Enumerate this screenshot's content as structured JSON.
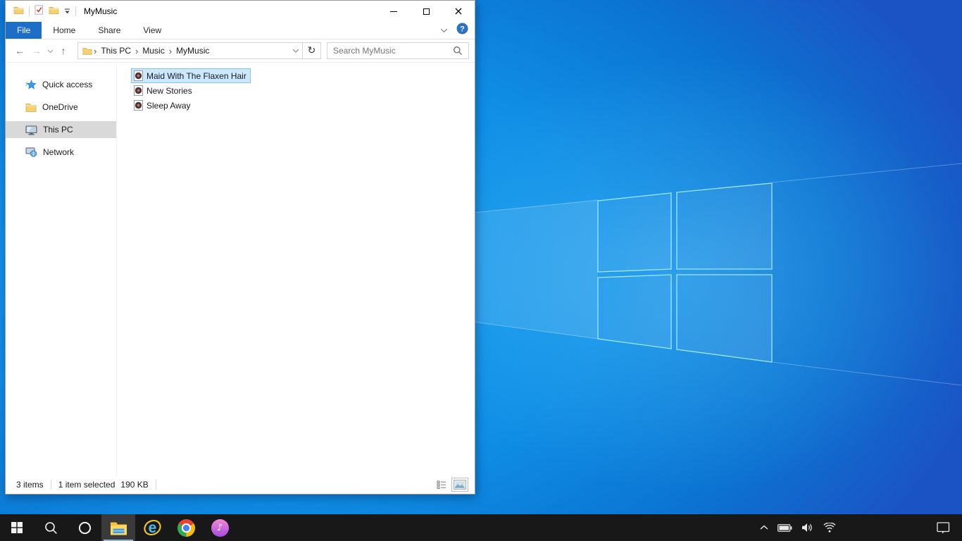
{
  "window": {
    "title": "MyMusic",
    "qat": {
      "icons": [
        "explorer-folder-icon",
        "properties-icon",
        "new-folder-icon",
        "customize-dropdown-icon"
      ]
    },
    "controls": {
      "minimize": "minimize",
      "maximize": "maximize",
      "close": "close"
    },
    "tabs": [
      {
        "label": "File",
        "active": true
      },
      {
        "label": "Home",
        "active": false
      },
      {
        "label": "Share",
        "active": false
      },
      {
        "label": "View",
        "active": false
      }
    ],
    "ribbon_right": [
      "collapse-ribbon-chevron",
      "help-icon"
    ],
    "navigation": {
      "back": "←",
      "forward": "→",
      "recent": "chevron-down",
      "up": "↑",
      "refresh": "↻"
    },
    "breadcrumb": {
      "segments": [
        "This PC",
        "Music",
        "MyMusic"
      ],
      "separator": "›"
    },
    "search": {
      "placeholder": "Search MyMusic"
    },
    "sidebar": {
      "items": [
        {
          "label": "Quick access",
          "icon": "quick-access-star-icon",
          "selected": false
        },
        {
          "label": "OneDrive",
          "icon": "onedrive-folder-icon",
          "selected": false
        },
        {
          "label": "This PC",
          "icon": "this-pc-monitor-icon",
          "selected": true
        },
        {
          "label": "Network",
          "icon": "network-icon",
          "selected": false
        }
      ]
    },
    "files": [
      {
        "name": "Maid With The Flaxen Hair",
        "icon": "audio-file-icon",
        "selected": true
      },
      {
        "name": "New Stories",
        "icon": "audio-file-icon",
        "selected": false
      },
      {
        "name": "Sleep Away",
        "icon": "audio-file-icon",
        "selected": false
      }
    ],
    "statusbar": {
      "items_count": "3 items",
      "selection": "1 item selected",
      "selection_size": "190 KB",
      "view_buttons": [
        "details-view-icon",
        "large-icons-view-icon"
      ]
    }
  },
  "taskbar": {
    "buttons": [
      {
        "icon": "start-icon"
      },
      {
        "icon": "search-icon"
      },
      {
        "icon": "cortana-icon"
      },
      {
        "icon": "file-explorer-icon",
        "active": true
      },
      {
        "icon": "internet-explorer-icon"
      },
      {
        "icon": "chrome-icon"
      },
      {
        "icon": "itunes-icon",
        "glyph": "♪"
      }
    ],
    "tray": [
      "tray-chevron-up-icon",
      "battery-icon",
      "volume-icon",
      "wifi-icon",
      "action-center-icon"
    ]
  },
  "colors": {
    "file_tab_blue": "#1c6ec6",
    "selection_bg": "#cce8ff",
    "selection_border": "#84c3ef",
    "sidebar_selected_bg": "#d9d9d9",
    "taskbar_bg": "#181818",
    "taskbar_active_underline": "#85b9dc",
    "wallpaper_bright": "#1ba1f2",
    "wallpaper_dark": "#1b53c4",
    "window_bg": "#ffffff"
  }
}
